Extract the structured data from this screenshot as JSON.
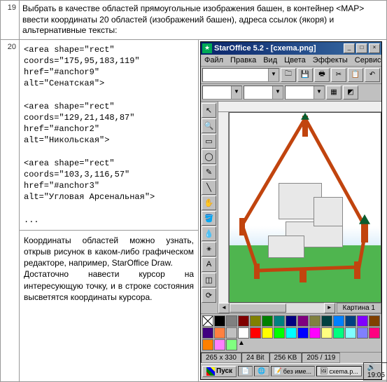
{
  "rows": {
    "r19": {
      "num": "19",
      "text": "Выбрать в качестве областей прямоугольные изображения башен, в контейнер <MAP> ввести координаты 20 областей (изображений башен), адреса ссылок (якоря) и альтернативные тексты:"
    },
    "r20": {
      "num": "20",
      "code": "<area shape=\"rect\"\ncoords=\"175,95,183,119\"\nhref=\"#anchor9\"\nalt=\"Сенатская\">\n\n<area shape=\"rect\"\ncoords=\"129,21,148,87\"\nhref=\"#anchor2\"\nalt=\"Никольская\">\n\n<area shape=\"rect\"\ncoords=\"103,3,116,57\"\nhref=\"#anchor3\"\nalt=\"Угловая Арсенальная\">\n\n...",
      "note1": "Координаты областей можно узнать, открыв рисунок в каком-либо графическом редакторе, например, StarOffice Draw.",
      "note2": "Достаточно навести курсор на интересующую точку, и в строке состояния высветятся координаты курсора."
    }
  },
  "app": {
    "title": "StarOffice 5.2 - [cxema.png]",
    "menu": [
      "Файл",
      "Правка",
      "Вид",
      "Цвета",
      "Эффекты",
      "Сервис"
    ],
    "tab": "Картина 1",
    "status": {
      "dim": "265 x 330",
      "depth": "24 Bit",
      "size": "256 KB",
      "pos": "205 / 119"
    },
    "taskbar": {
      "start": "Пуск",
      "task1": "без име...",
      "task2": "cxema.p...",
      "clock": "19:05"
    },
    "palette_colors": [
      "#000",
      "#808080",
      "#800000",
      "#808000",
      "#008000",
      "#008080",
      "#000080",
      "#800080",
      "#808040",
      "#004040",
      "#0080ff",
      "#004080",
      "#8000ff",
      "#804000",
      "#400080",
      "#ff8040",
      "#c0c0c0",
      "#fff",
      "#f00",
      "#ff0",
      "#0f0",
      "#0ff",
      "#00f",
      "#f0f",
      "#ffff80",
      "#00ff80",
      "#80ffff",
      "#8080ff",
      "#ff0080",
      "#ff8000",
      "#ff80ff",
      "#80ff80"
    ]
  }
}
